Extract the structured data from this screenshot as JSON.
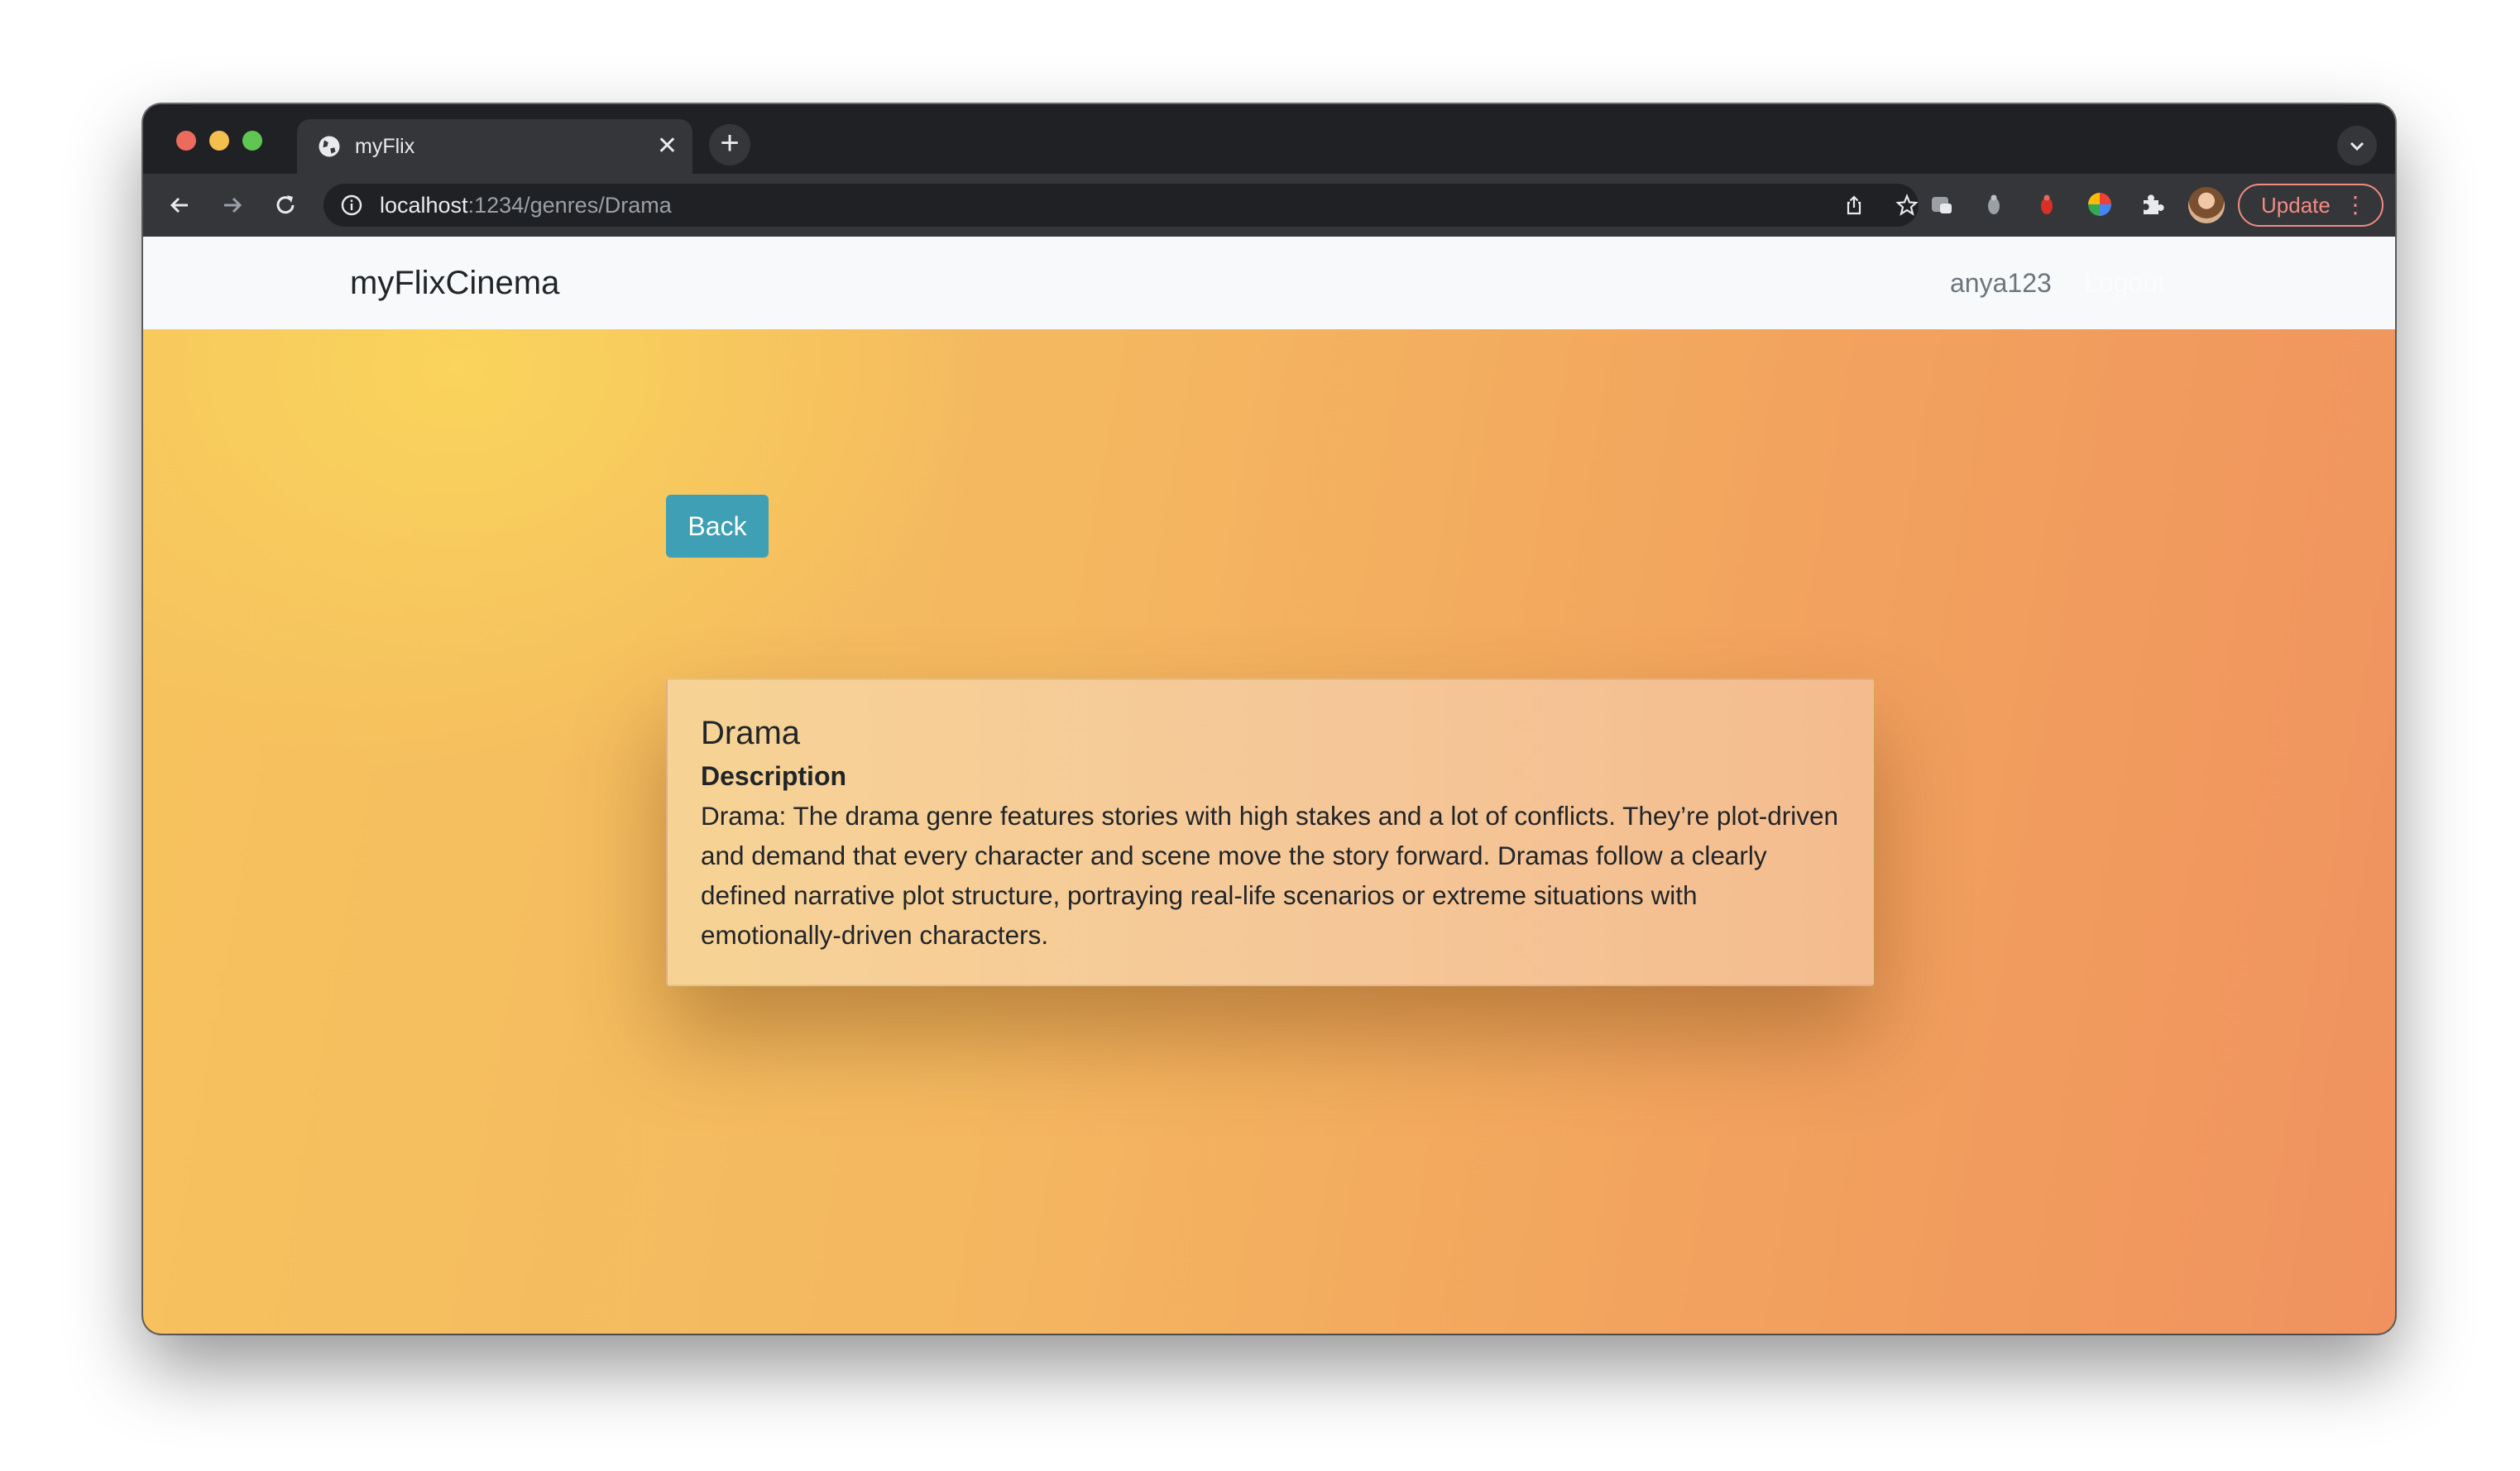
{
  "browser": {
    "tab_title": "myFlix",
    "new_tab_symbol": "+",
    "close_symbol": "✕",
    "url_host": "localhost",
    "url_path": ":1234/genres/Drama",
    "update_label": "Update",
    "menu_symbol": "⋮",
    "icons": [
      "back-arrow-icon",
      "forward-arrow-icon",
      "reload-icon",
      "site-info-icon",
      "share-icon",
      "bookmark-star-icon",
      "extension-icon",
      "puzzle-extensions-icon",
      "profile-avatar"
    ]
  },
  "navbar": {
    "brand": "myFlixCinema",
    "username": "anya123",
    "logout": "Logout"
  },
  "main": {
    "back_label": "Back",
    "genre": {
      "name": "Drama",
      "description_heading": "Description",
      "description": "Drama: The drama genre features stories with high stakes and a lot of conflicts. They’re plot-driven and demand that every character and scene move the story forward. Dramas follow a clearly defined narrative plot structure, portraying real-life scenarios or extreme situations with emotionally-driven characters."
    }
  },
  "colors": {
    "back_button": "#3f9fb4",
    "navbar_bg": "#f8f9fa",
    "gradient_start": "#f6c35e",
    "gradient_end": "#f0925f",
    "update_accent": "#f28b82"
  }
}
